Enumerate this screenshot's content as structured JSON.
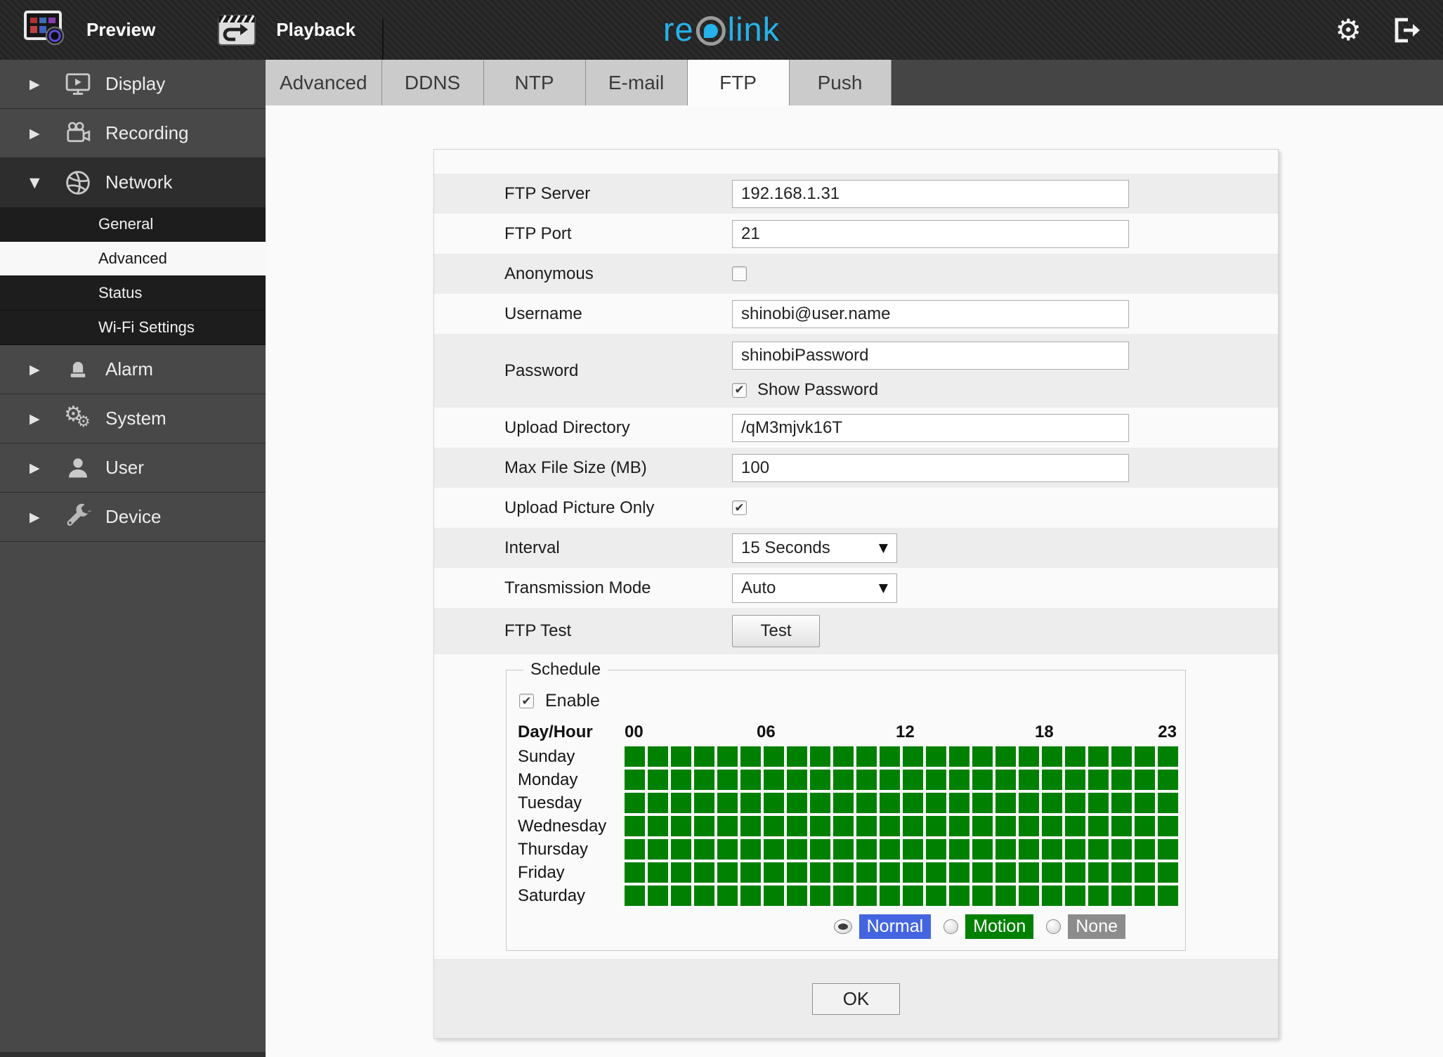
{
  "topbar": {
    "preview_label": "Preview",
    "playback_label": "Playback"
  },
  "logo": {
    "part1": "re",
    "part2": "link",
    "accent": "#25b2ea",
    "ring": "#9b9b9b"
  },
  "sidebar": {
    "items": [
      {
        "label": "Display",
        "icon": "display-icon",
        "expanded": false
      },
      {
        "label": "Recording",
        "icon": "recording-icon",
        "expanded": false
      },
      {
        "label": "Network",
        "icon": "network-icon",
        "expanded": true,
        "children": [
          {
            "label": "General",
            "active": false
          },
          {
            "label": "Advanced",
            "active": true
          },
          {
            "label": "Status",
            "active": false
          },
          {
            "label": "Wi-Fi Settings",
            "active": false
          }
        ]
      },
      {
        "label": "Alarm",
        "icon": "alarm-icon",
        "expanded": false
      },
      {
        "label": "System",
        "icon": "system-icon",
        "expanded": false
      },
      {
        "label": "User",
        "icon": "user-icon",
        "expanded": false
      },
      {
        "label": "Device",
        "icon": "device-icon",
        "expanded": false
      }
    ]
  },
  "tabs": [
    {
      "label": "Advanced",
      "active": false
    },
    {
      "label": "DDNS",
      "active": false
    },
    {
      "label": "NTP",
      "active": false
    },
    {
      "label": "E-mail",
      "active": false
    },
    {
      "label": "FTP",
      "active": true
    },
    {
      "label": "Push",
      "active": false
    }
  ],
  "form": {
    "fields": [
      {
        "label": "FTP Server",
        "type": "text",
        "value": "192.168.1.31"
      },
      {
        "label": "FTP Port",
        "type": "text",
        "value": "21"
      },
      {
        "label": "Anonymous",
        "type": "checkbox",
        "checked": false
      },
      {
        "label": "Username",
        "type": "text",
        "value": "shinobi@user.name"
      },
      {
        "label": "Password",
        "type": "password",
        "value": "shinobiPassword",
        "show_password_label": "Show Password",
        "show_password_checked": true
      },
      {
        "label": "Upload Directory",
        "type": "text",
        "value": "/qM3mjvk16T"
      },
      {
        "label": "Max File Size (MB)",
        "type": "text",
        "value": "100"
      },
      {
        "label": "Upload Picture Only",
        "type": "checkbox",
        "checked": true
      },
      {
        "label": "Interval",
        "type": "select",
        "value": "15 Seconds"
      },
      {
        "label": "Transmission Mode",
        "type": "select",
        "value": "Auto"
      },
      {
        "label": "FTP Test",
        "type": "button",
        "button_label": "Test"
      }
    ]
  },
  "schedule": {
    "legend": "Schedule",
    "enable_label": "Enable",
    "enable_checked": true,
    "corner_label": "Day/Hour",
    "hour_labels": [
      {
        "text": "00",
        "col": 0
      },
      {
        "text": "06",
        "col": 6
      },
      {
        "text": "12",
        "col": 12
      },
      {
        "text": "18",
        "col": 18
      },
      {
        "text": "23",
        "col": 23
      }
    ],
    "hours_per_day": 24,
    "days": [
      "Sunday",
      "Monday",
      "Tuesday",
      "Wednesday",
      "Thursday",
      "Friday",
      "Saturday"
    ],
    "cell_state_all": "motion",
    "cell_color": "#008000",
    "modes": [
      {
        "label": "Normal",
        "color": "#4565e0",
        "selected": true
      },
      {
        "label": "Motion",
        "color": "#008000",
        "selected": false
      },
      {
        "label": "None",
        "color": "#8c8c8c",
        "selected": false
      }
    ]
  },
  "ok_label": "OK"
}
